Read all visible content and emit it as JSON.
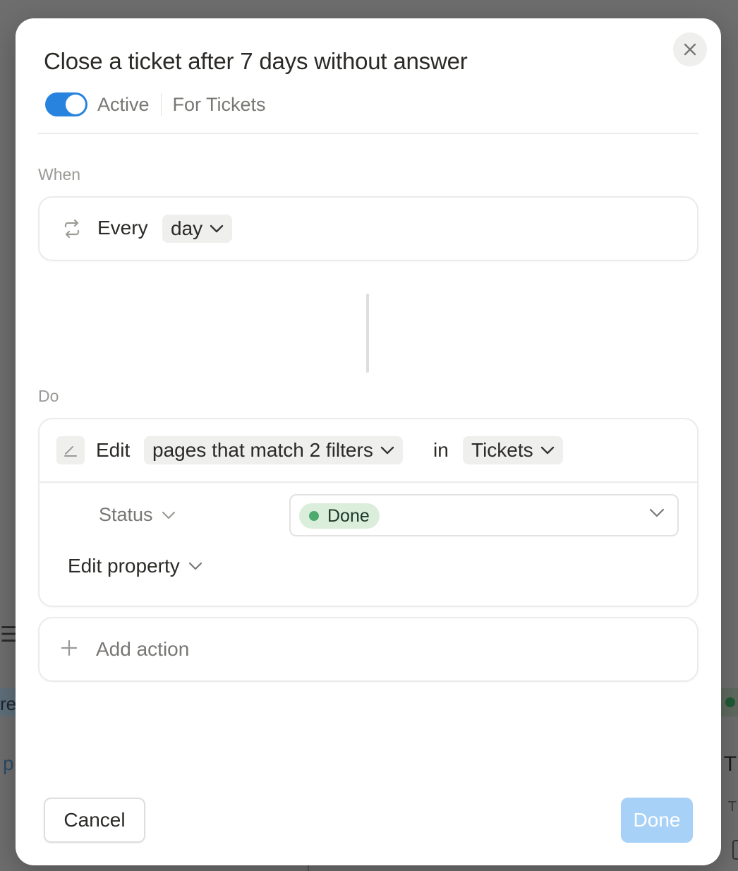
{
  "background": {
    "left_fragment_1": "re",
    "left_fragment_2": "p",
    "left_icon": "list-icon",
    "right_fragment_1": "T",
    "right_fragment_2": "T"
  },
  "modal": {
    "title": "Close a ticket after 7 days without answer",
    "active_toggle": {
      "on": true,
      "label": "Active",
      "color": "#2783de"
    },
    "scope_label": "For Tickets",
    "close_icon": "close-icon"
  },
  "when": {
    "section_label": "When",
    "trigger_icon": "repeat-icon",
    "every_label": "Every",
    "frequency": "day"
  },
  "do": {
    "section_label": "Do",
    "action_icon": "edit-pencil-icon",
    "action_label": "Edit",
    "target": "pages that match 2 filters",
    "in_label": "in",
    "database": "Tickets",
    "property_name": "Status",
    "property_value": {
      "label": "Done",
      "dot_color": "#4dab6f",
      "bg_color": "#dbeddb"
    },
    "edit_property_label": "Edit property"
  },
  "add_action": {
    "icon": "plus-icon",
    "label": "Add action"
  },
  "footer": {
    "cancel_label": "Cancel",
    "done_label": "Done",
    "done_color": "#a8d1f7"
  }
}
